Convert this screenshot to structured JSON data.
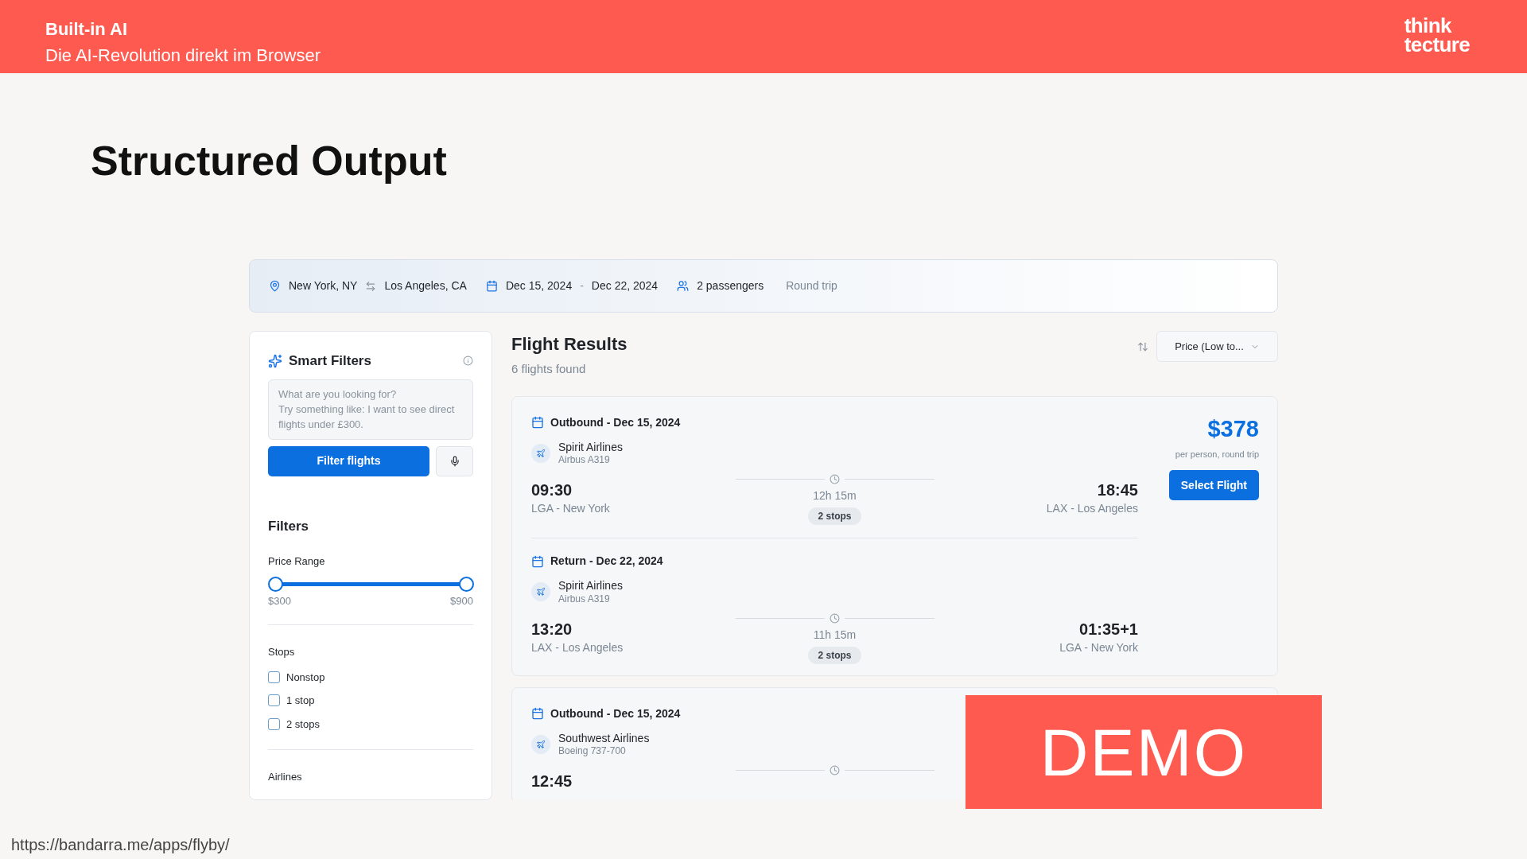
{
  "slide_header": {
    "title": "Built-in AI",
    "subtitle": "Die AI-Revolution direkt im Browser",
    "logo_lines": [
      "think",
      "tecture"
    ]
  },
  "slide_title": "Structured Output",
  "search_bar": {
    "origin": "New York, NY",
    "destination": "Los Angeles, CA",
    "depart_date": "Dec 15, 2024",
    "date_separator": "-",
    "return_date": "Dec 22, 2024",
    "passengers": "2 passengers",
    "trip_type": "Round trip"
  },
  "smart_filters": {
    "title": "Smart Filters",
    "placeholder": "What are you looking for?\nTry something like: I want to see direct flights under £300.",
    "button": "Filter flights"
  },
  "filters": {
    "title": "Filters",
    "price_range": {
      "label": "Price Range",
      "thumbs": [
        {
          "level": 0
        },
        {
          "level": 1
        }
      ],
      "min": "$300",
      "max": "$900"
    },
    "stops": {
      "label": "Stops",
      "options": [
        {
          "label": "Nonstop",
          "checked": false
        },
        {
          "label": "1 stop",
          "checked": false
        },
        {
          "label": "2 stops",
          "checked": false
        }
      ]
    },
    "airlines": {
      "label": "Airlines"
    }
  },
  "results": {
    "title": "Flight Results",
    "count": "6 flights found",
    "sort": "Price (Low to..."
  },
  "flights": [
    {
      "price": "$378",
      "price_note": "per person, round trip",
      "button": "Select Flight",
      "segments": [
        {
          "label": "Outbound - Dec 15, 2024",
          "airline": "Spirit Airlines",
          "aircraft": "Airbus A319",
          "depart_time": "09:30",
          "depart_airport": "LGA - New York",
          "duration": "12h 15m",
          "stops": "2 stops",
          "arrive_time": "18:45",
          "arrive_airport": "LAX - Los Angeles"
        },
        {
          "label": "Return - Dec 22, 2024",
          "airline": "Spirit Airlines",
          "aircraft": "Airbus A319",
          "depart_time": "13:20",
          "depart_airport": "LAX - Los Angeles",
          "duration": "11h 15m",
          "stops": "2 stops",
          "arrive_time": "01:35+1",
          "arrive_airport": "LGA - New York"
        }
      ]
    },
    {
      "segments": [
        {
          "label": "Outbound - Dec 15, 2024",
          "airline": "Southwest Airlines",
          "aircraft": "Boeing 737-700",
          "depart_time": "12:45"
        }
      ]
    }
  ],
  "demo_badge": "DEMO",
  "footer_url": "https://bandarra.me/apps/flyby/"
}
